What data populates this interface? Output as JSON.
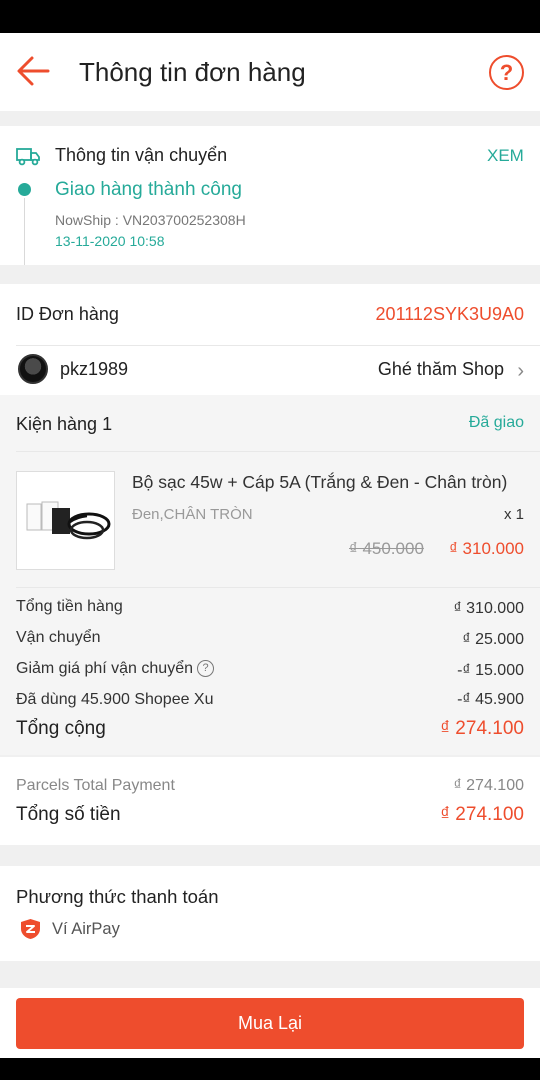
{
  "header": {
    "title": "Thông tin đơn hàng"
  },
  "shipping": {
    "title": "Thông tin vận chuyển",
    "view_label": "XEM",
    "status": "Giao hàng thành công",
    "tracking": "NowShip :  VN203700252308H",
    "datetime": "13-11-2020 10:58"
  },
  "order": {
    "id_label": "ID Đơn hàng",
    "id_value": "201112SYK3U9A0"
  },
  "shop": {
    "name": "pkz1989",
    "visit_label": "Ghé thăm Shop"
  },
  "package": {
    "title": "Kiện hàng 1",
    "status": "Đã giao",
    "product": {
      "name": "Bộ sạc 45w + Cáp 5A (Trắng & Đen - Chân tròn)",
      "variant": "Đen,CHÂN TRÒN",
      "qty": "x 1",
      "old_price": "₫ 450.000",
      "price": "₫ 310.000"
    },
    "summary": [
      {
        "label": "Tổng tiền hàng",
        "value": "₫ 310.000"
      },
      {
        "label": "Vận chuyển",
        "value": "₫ 25.000"
      },
      {
        "label": "Giảm giá phí vận chuyển",
        "value": "-₫ 15.000"
      },
      {
        "label": "Đã dùng 45.900 Shopee Xu",
        "value": "-₫ 45.900"
      }
    ],
    "total_label": "Tổng cộng",
    "total_value": "₫ 274.100"
  },
  "payment_total": {
    "parcels_label": "Parcels Total Payment",
    "parcels_value": "₫ 274.100",
    "total_label": "Tổng số tiền",
    "total_value": "₫ 274.100"
  },
  "payment_method": {
    "title": "Phương thức thanh toán",
    "name": "Ví AirPay"
  },
  "actions": {
    "rebuy_label": "Mua Lại"
  },
  "colors": {
    "accent": "#ee4d2d",
    "teal": "#26aa99"
  }
}
